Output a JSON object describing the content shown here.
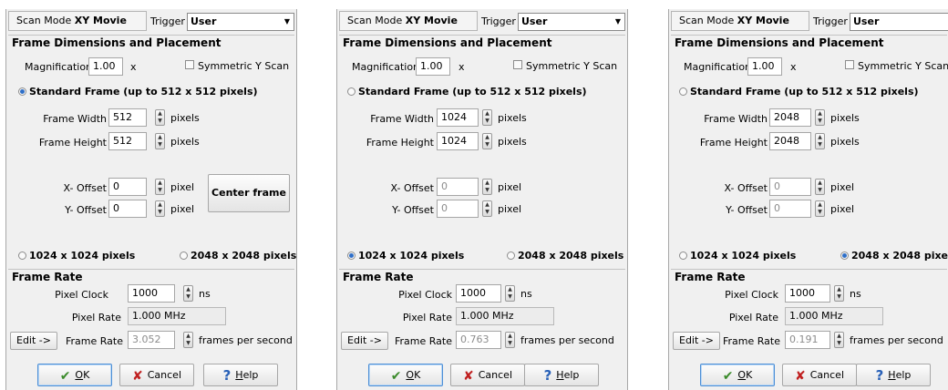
{
  "common": {
    "scan_mode_prefix": "Scan Mode",
    "scan_mode_value": "XY Movie",
    "trigger_label": "Trigger",
    "trigger_value": "User",
    "frame_section_title": "Frame Dimensions and Placement",
    "magnification_label": "Magnification",
    "magnification_value": "1.00",
    "magnification_unit": "x",
    "symmetric_label": "Symmetric Y Scan",
    "standard_frame_label": "Standard Frame (up to 512 x 512 pixels)",
    "frame_width_label": "Frame Width",
    "frame_height_label": "Frame Height",
    "pixels_unit": "pixels",
    "x_offset_label": "X- Offset",
    "y_offset_label": "Y- Offset",
    "pixel_unit": "pixel",
    "center_frame_label": "Center frame",
    "option_1024_label": "1024 x 1024 pixels",
    "option_2048_label": "2048 x 2048 pixels",
    "frame_rate_section_title": "Frame Rate",
    "pixel_clock_label": "Pixel Clock",
    "pixel_clock_value": "1000",
    "ns_unit": "ns",
    "pixel_rate_label": "Pixel Rate",
    "pixel_rate_value": "1.000 MHz",
    "edit_label": "Edit ->",
    "frame_rate_label": "Frame Rate",
    "fps_unit": "frames per second",
    "ok_underlined": "O",
    "ok_rest": "K",
    "cancel_label": "Cancel",
    "help_underlined": "H",
    "help_rest": "elp",
    "icons": {
      "ok": "check-icon",
      "cancel": "x-icon",
      "help": "question-icon",
      "spin": "spin-arrows-icon",
      "dropdown": "chevron-down-icon"
    }
  },
  "panels": [
    {
      "frame_width": "512",
      "frame_height": "512",
      "x_offset": "0",
      "y_offset": "0",
      "frame_rate": "3.052",
      "selected": "standard"
    },
    {
      "frame_width": "1024",
      "frame_height": "1024",
      "x_offset": "0",
      "y_offset": "0",
      "frame_rate": "0.763",
      "selected": "1024"
    },
    {
      "frame_width": "2048",
      "frame_height": "2048",
      "x_offset": "0",
      "y_offset": "0",
      "frame_rate": "0.191",
      "selected": "2048"
    }
  ]
}
